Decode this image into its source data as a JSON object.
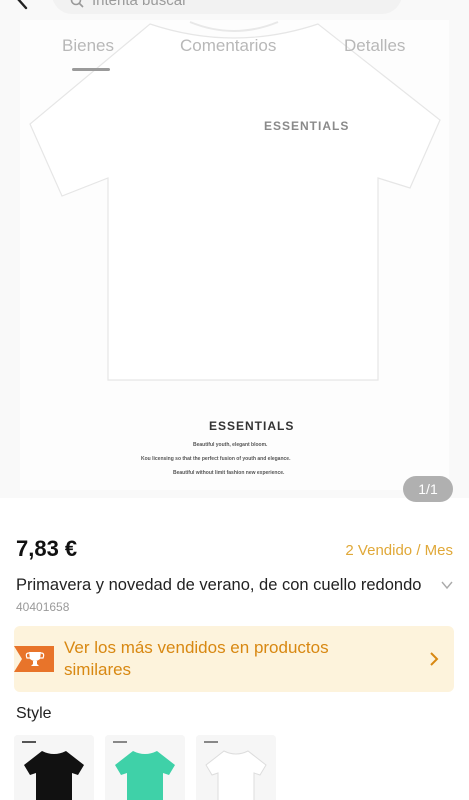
{
  "search": {
    "placeholder": "Intenta buscar"
  },
  "tabs": [
    {
      "label": "Bienes",
      "active": true
    },
    {
      "label": "Comentarios",
      "active": false
    },
    {
      "label": "Detalles",
      "active": false
    }
  ],
  "product_image": {
    "brand_print": "ESSENTIALS",
    "caption_title": "ESSENTIALS",
    "caption_lines": [
      "Beautiful youth, elegant bloom.",
      "Kou licensing so that the perfect fusion of youth and elegance.",
      "Beautiful without limit fashion new experience."
    ]
  },
  "gallery": {
    "counter": "1/1"
  },
  "product": {
    "price": "7,83 €",
    "sold": "2 Vendido / Mes",
    "title": "Primavera y novedad de verano, de con cuello redondo",
    "sku": "40401658"
  },
  "banner": {
    "text": "Ver los más vendidos en productos similares"
  },
  "style": {
    "label": "Style",
    "options": [
      {
        "name": "black",
        "color": "#111111"
      },
      {
        "name": "mint",
        "color": "#3fd1a8"
      },
      {
        "name": "white",
        "color": "#f4f4f4"
      }
    ]
  },
  "colors": {
    "accent": "#e0a838",
    "banner_bg": "#fdf3dc",
    "banner_text": "#d88812",
    "badge": "#e8742a"
  }
}
